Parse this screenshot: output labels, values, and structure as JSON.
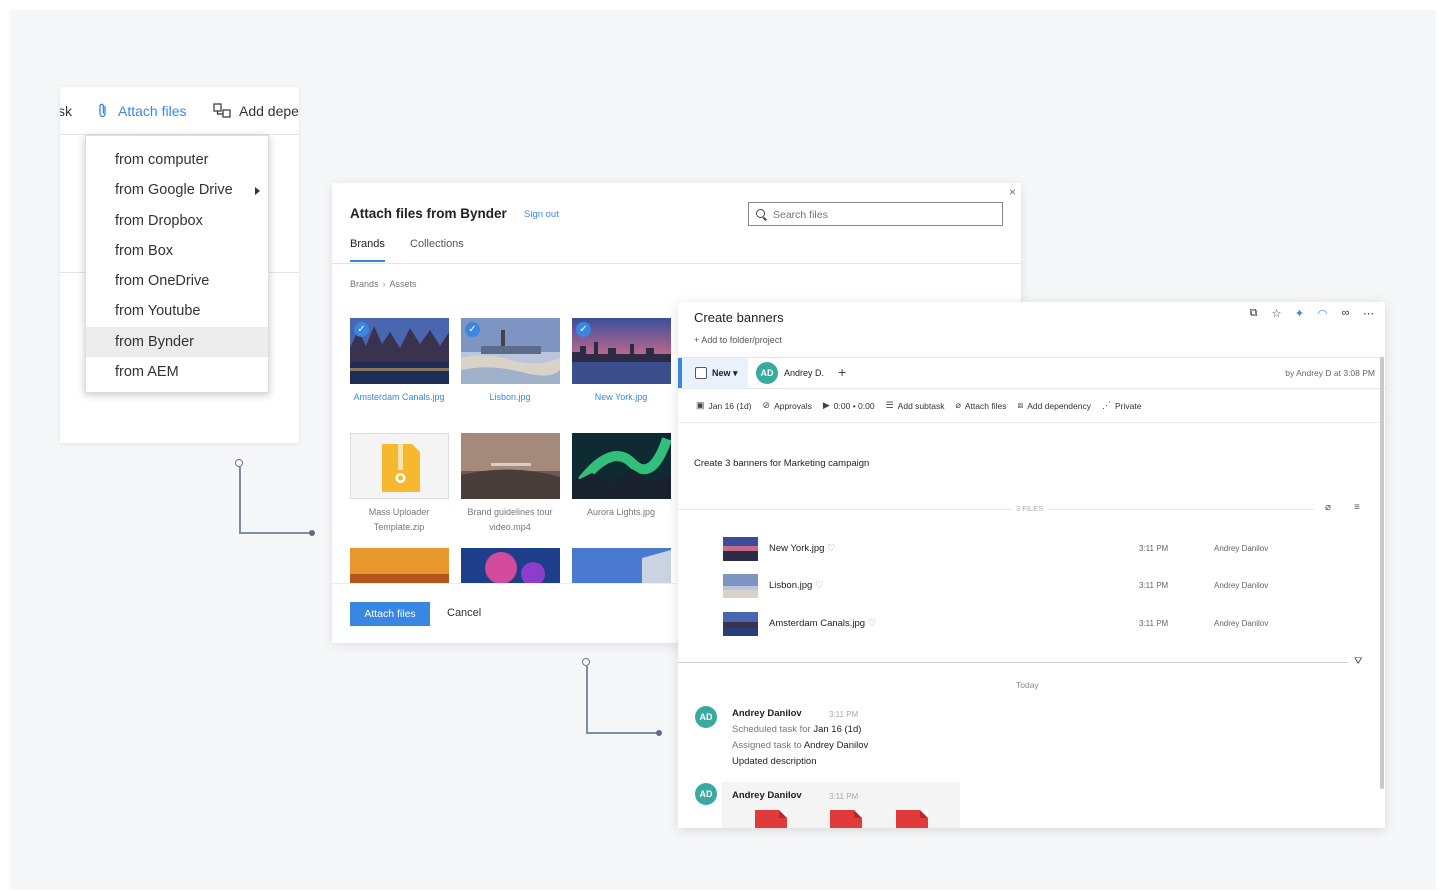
{
  "toolbar": {
    "task_label": "sk",
    "attach_label": "Attach files",
    "dependency_label": "Add depe"
  },
  "attach_menu": {
    "items": [
      {
        "label": "from computer"
      },
      {
        "label": "from Google Drive"
      },
      {
        "label": "from Dropbox"
      },
      {
        "label": "from Box"
      },
      {
        "label": "from OneDrive"
      },
      {
        "label": "from Youtube"
      },
      {
        "label": "from Bynder"
      },
      {
        "label": "from AEM"
      }
    ],
    "active": "from Bynder"
  },
  "bynder": {
    "title": "Attach files from Bynder",
    "sign_out": "Sign out",
    "close": "×",
    "search_placeholder": "Search files",
    "tabs": [
      {
        "label": "Brands"
      },
      {
        "label": "Collections"
      }
    ],
    "breadcrumb": [
      "Brands",
      "Assets"
    ],
    "breadcrumb_sep": "›",
    "assets": [
      {
        "name": "Amsterdam Canals.jpg",
        "selected": true
      },
      {
        "name": "Lisbon.jpg",
        "selected": true
      },
      {
        "name": "New York.jpg",
        "selected": true
      },
      {
        "name": "Mass Uploader Template.zip",
        "selected": false
      },
      {
        "name": "Brand guidelines tour video.mp4",
        "selected": false
      },
      {
        "name": "Aurora Lights.jpg",
        "selected": false
      }
    ],
    "check": "✓",
    "attach_button": "Attach files",
    "cancel_button": "Cancel"
  },
  "task": {
    "title": "Create banners",
    "add_to_folder": "Add to folder/project",
    "status": "New",
    "assignee_initials": "AD",
    "assignee_name": "Andrey D.",
    "created_by": "by Andrey D at 3:08 PM",
    "toolbar": {
      "date": "Jan 16 (1d)",
      "approvals": "Approvals",
      "timer": "0:00 • 0:00",
      "subtask": "Add subtask",
      "attach": "Attach files",
      "dependency": "Add dependency",
      "privacy": "Private"
    },
    "description": "Create 3 banners for Marketing campaign",
    "files_label": "3 FILES",
    "files": [
      {
        "name": "New York.jpg",
        "time": "3:11 PM",
        "user": "Andrey Danilov"
      },
      {
        "name": "Lisbon.jpg",
        "time": "3:11 PM",
        "user": "Andrey Danilov"
      },
      {
        "name": "Amsterdam Canals.jpg",
        "time": "3:11 PM",
        "user": "Andrey Danilov"
      }
    ],
    "today_label": "Today",
    "activity": [
      {
        "initials": "AD",
        "name": "Andrey Danilov",
        "time": "3:11 PM",
        "line1_prefix": "Scheduled task for ",
        "line1_value": "Jan 16 (1d)",
        "line2_prefix": "Assigned task to ",
        "line2_value": "Andrey Danilov",
        "line3": "Updated description"
      },
      {
        "initials": "AD",
        "name": "Andrey Danilov",
        "time": "3:11 PM"
      }
    ]
  }
}
